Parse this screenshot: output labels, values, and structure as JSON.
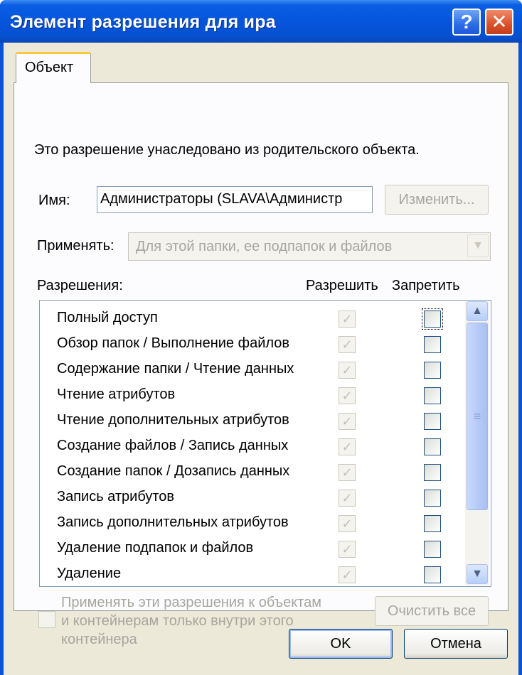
{
  "window": {
    "title": "Элемент разрешения для ира",
    "help_glyph": "?",
    "close_glyph": "✕"
  },
  "tab": {
    "label": "Объект"
  },
  "inherited_note": "Это разрешение унаследовано из родительского объекта.",
  "name_field": {
    "label": "Имя:",
    "value": "Администраторы (SLAVA\\Администр",
    "change_button": "Изменить..."
  },
  "apply_to": {
    "label": "Применять:",
    "value": "Для этой папки, ее подпапок и файлов"
  },
  "permissions": {
    "label": "Разрешения:",
    "allow_header": "Разрешить",
    "deny_header": "Запретить",
    "rows": [
      {
        "name": "Полный доступ",
        "allow": true,
        "deny": false
      },
      {
        "name": "Обзор папок / Выполнение файлов",
        "allow": true,
        "deny": false
      },
      {
        "name": "Содержание папки / Чтение данных",
        "allow": true,
        "deny": false
      },
      {
        "name": "Чтение атрибутов",
        "allow": true,
        "deny": false
      },
      {
        "name": "Чтение дополнительных атрибутов",
        "allow": true,
        "deny": false
      },
      {
        "name": "Создание файлов / Запись данных",
        "allow": true,
        "deny": false
      },
      {
        "name": "Создание папок / Дозапись данных",
        "allow": true,
        "deny": false
      },
      {
        "name": "Запись атрибутов",
        "allow": true,
        "deny": false
      },
      {
        "name": "Запись дополнительных атрибутов",
        "allow": true,
        "deny": false
      },
      {
        "name": "Удаление подпапок и файлов",
        "allow": true,
        "deny": false
      },
      {
        "name": "Удаление",
        "allow": true,
        "deny": false
      }
    ]
  },
  "apply_inside": {
    "line1": "Применять эти разрешения к объектам",
    "line2": "и контейнерам только внутри этого",
    "line3": "контейнера",
    "checked": false
  },
  "clear_all_button": "Очистить все",
  "ok_button": "OK",
  "cancel_button": "Отмена",
  "colors": {
    "titlebar": "#0555dc",
    "dialog_bg": "#ece9d8",
    "disabled_text": "#a7a69e"
  }
}
